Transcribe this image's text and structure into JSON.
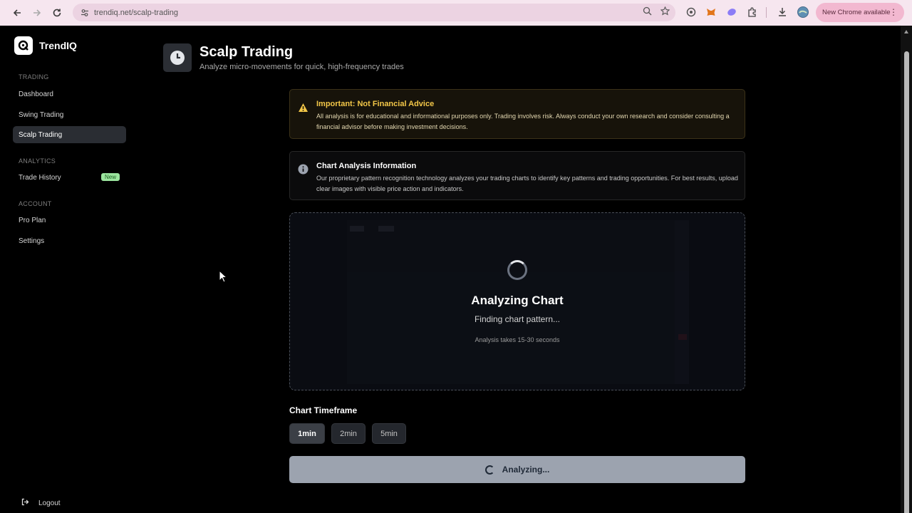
{
  "browser": {
    "url": "trendiq.net/scalp-trading",
    "update_label": "New Chrome available"
  },
  "sidebar": {
    "brand": "TrendIQ",
    "sections": [
      {
        "label": "TRADING",
        "items": [
          {
            "label": "Dashboard"
          },
          {
            "label": "Swing Trading"
          },
          {
            "label": "Scalp Trading",
            "active": true
          }
        ]
      },
      {
        "label": "ANALYTICS",
        "items": [
          {
            "label": "Trade History",
            "badge": "New"
          }
        ]
      },
      {
        "label": "ACCOUNT",
        "items": [
          {
            "label": "Pro Plan"
          },
          {
            "label": "Settings"
          }
        ]
      }
    ],
    "logout": "Logout"
  },
  "header": {
    "title": "Scalp Trading",
    "subtitle": "Analyze micro-movements for quick, high-frequency trades",
    "icon": "clock-icon"
  },
  "warning": {
    "title": "Important: Not Financial Advice",
    "body": "All analysis is for educational and informational purposes only. Trading involves risk. Always conduct your own research and consider consulting a financial advisor before making investment decisions.",
    "icon": "warning-icon"
  },
  "info": {
    "title": "Chart Analysis Information",
    "body": "Our proprietary pattern recognition technology analyzes your trading charts to identify key patterns and trading opportunities. For best results, upload clear images with visible price action and indicators.",
    "icon": "info-icon"
  },
  "analysis": {
    "title": "Analyzing Chart",
    "status": "Finding chart pattern...",
    "duration_note": "Analysis takes 15-30 seconds"
  },
  "timeframe": {
    "label": "Chart Timeframe",
    "options": [
      "1min",
      "2min",
      "5min"
    ],
    "selected": "1min"
  },
  "action": {
    "label": "Analyzing..."
  },
  "colors": {
    "warning_accent": "#f3c748",
    "badge_green": "#9be49e",
    "button_disabled": "#9ca3af"
  }
}
